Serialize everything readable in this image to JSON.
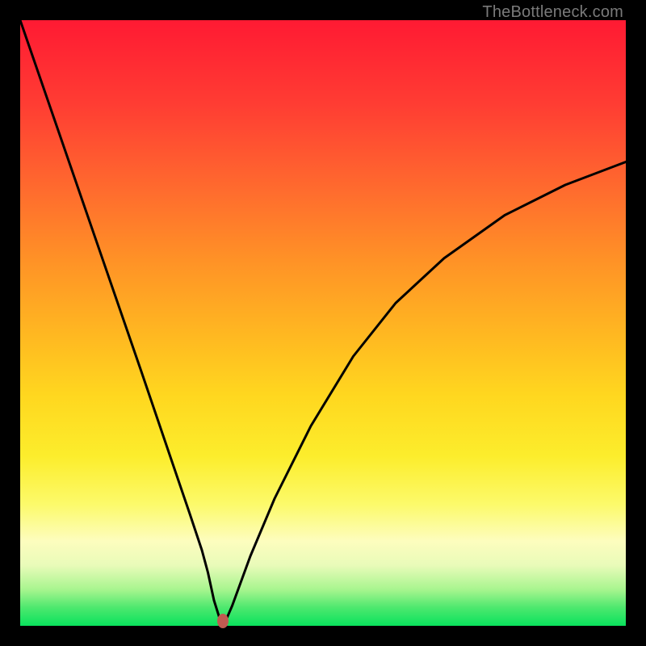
{
  "watermark": "TheBottleneck.com",
  "colors": {
    "gradient_top": "#ff1a33",
    "gradient_bottom": "#09e25d",
    "curve": "#000000",
    "marker": "#c15a51",
    "frame_bg": "#000000"
  },
  "chart_data": {
    "type": "line",
    "title": "",
    "xlabel": "",
    "ylabel": "",
    "xlim": [
      0,
      100
    ],
    "ylim": [
      0,
      100
    ],
    "grid": false,
    "series": [
      {
        "name": "bottleneck-curve",
        "x": [
          0,
          5,
          10,
          15,
          20,
          25,
          28,
          30,
          31,
          32,
          33,
          34,
          35,
          38,
          42,
          48,
          55,
          62,
          70,
          80,
          90,
          100
        ],
        "y": [
          100,
          85.5,
          71,
          56.5,
          42,
          27.3,
          18.5,
          12.5,
          8.8,
          4.2,
          1.0,
          1.0,
          3.3,
          11.5,
          21,
          33,
          44.5,
          53.3,
          60.7,
          67.8,
          72.8,
          76.6
        ]
      }
    ],
    "marker": {
      "x": 33.5,
      "y": 0.8
    }
  }
}
